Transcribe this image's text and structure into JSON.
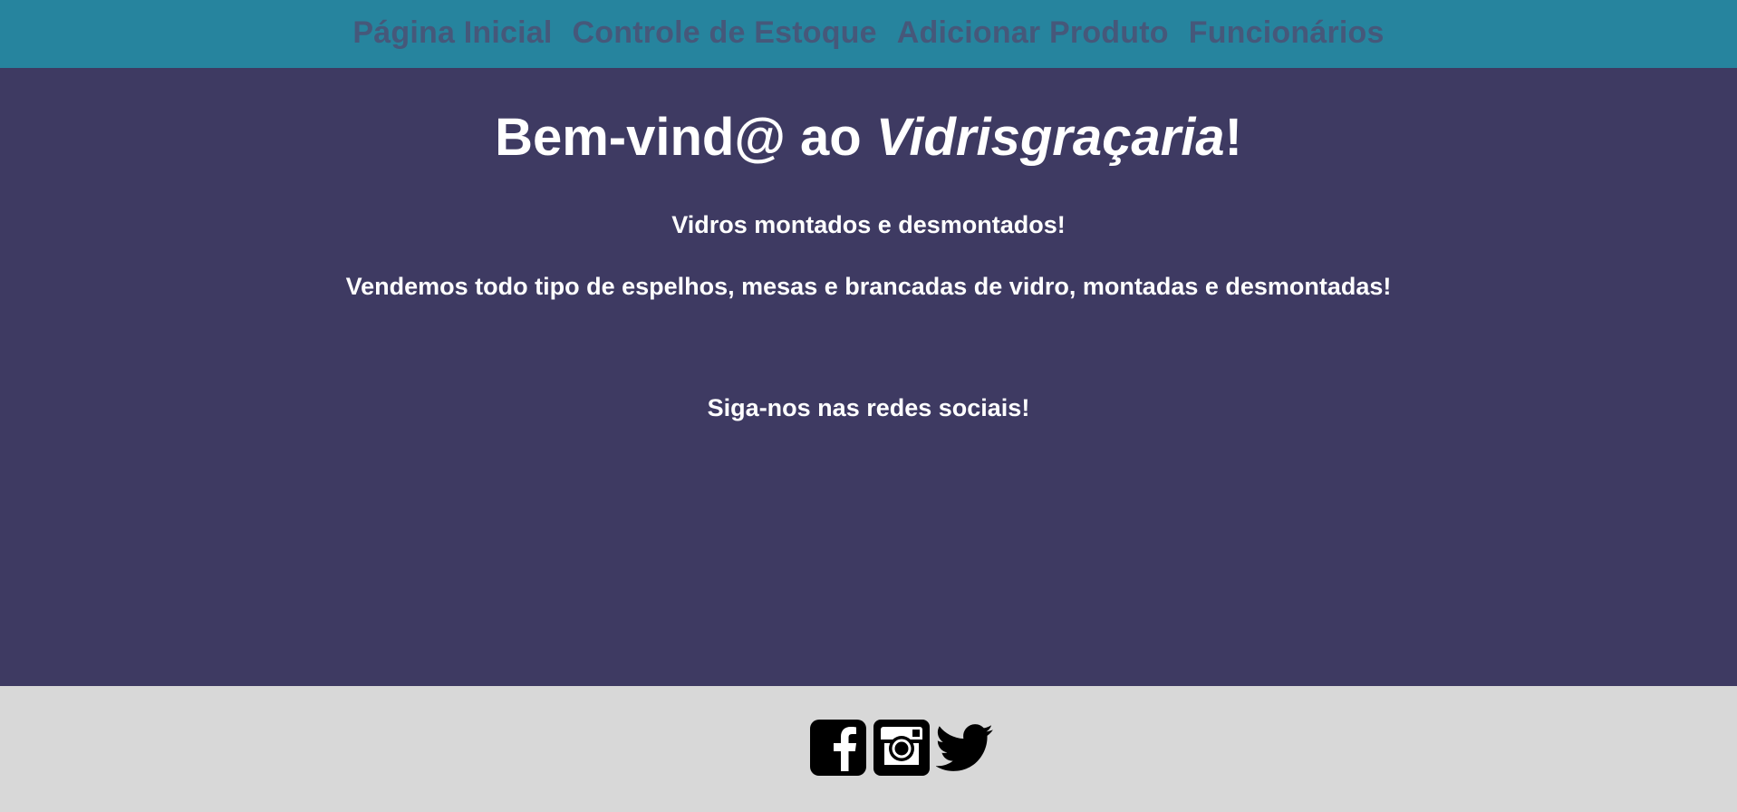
{
  "nav": {
    "items": [
      {
        "label": "Página Inicial"
      },
      {
        "label": "Controle de Estoque"
      },
      {
        "label": "Adicionar Produto"
      },
      {
        "label": "Funcionários"
      }
    ]
  },
  "main": {
    "title_prefix": "Bem-vind@ ao ",
    "title_brand": "Vidrisgraçaria",
    "title_suffix": "!",
    "tagline": "Vidros montados e desmontados!",
    "description": "Vendemos todo tipo de espelhos, mesas e brancadas de vidro, montadas e desmontadas!",
    "follow_text": "Siga-nos nas redes sociais!"
  },
  "footer": {
    "social_icons": [
      "facebook-icon",
      "instagram-icon",
      "twitter-icon"
    ]
  },
  "colors": {
    "nav_background": "#26849e",
    "nav_link": "#46587a",
    "main_background": "#3e3a62",
    "footer_background": "#d8d8d8"
  }
}
